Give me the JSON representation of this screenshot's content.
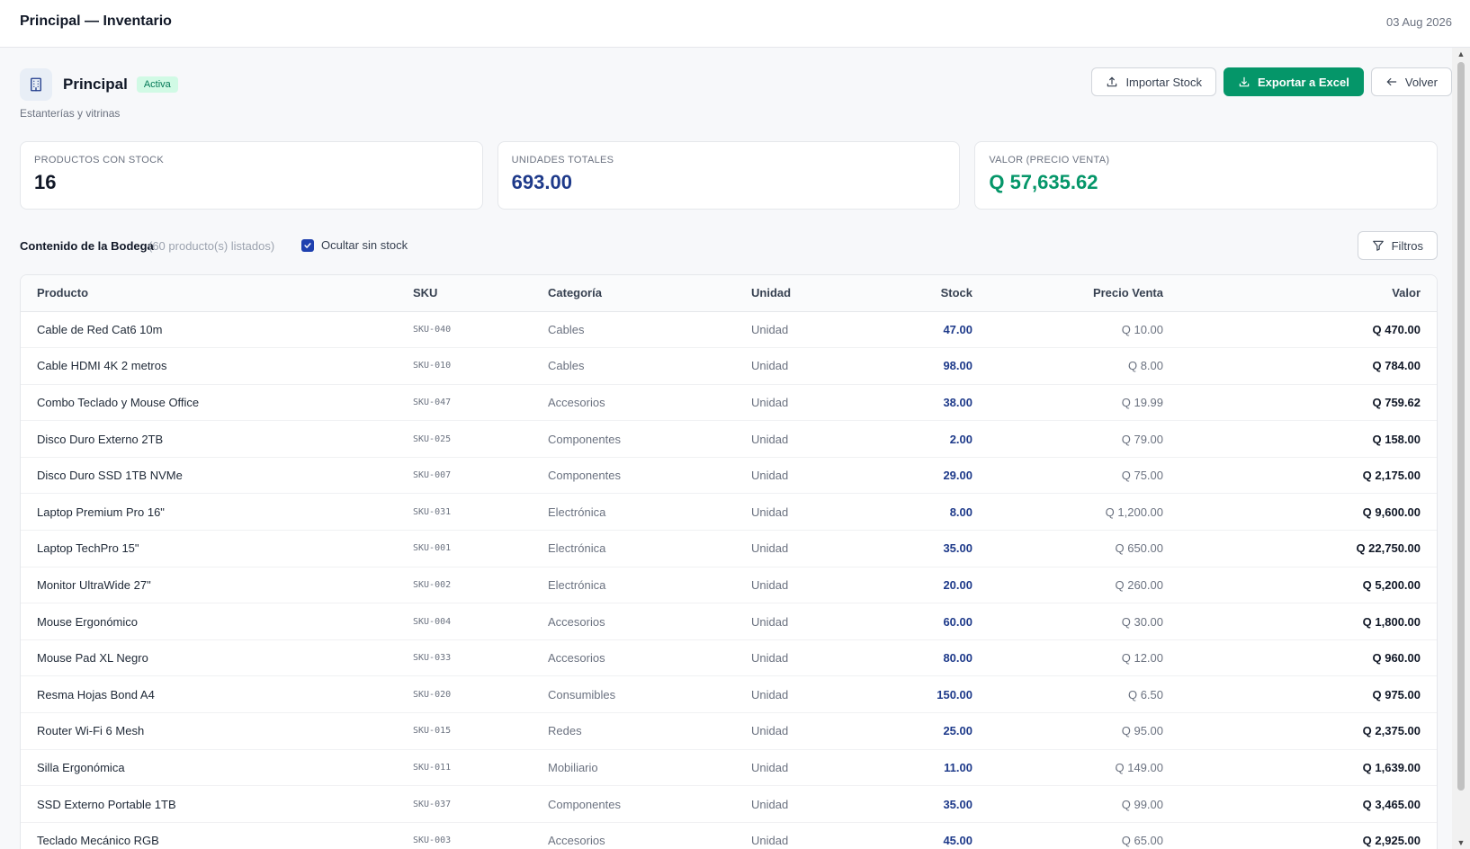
{
  "header": {
    "title": "Principal — Inventario",
    "date": "03 Aug 2026"
  },
  "warehouse": {
    "name": "Principal",
    "status": "Activa",
    "description": "Estanterías y vitrinas",
    "icon": "building-icon"
  },
  "actions": {
    "import_label": "Importar Stock",
    "export_label": "Exportar a Excel",
    "back_label": "Volver"
  },
  "stats": [
    {
      "label": "PRODUCTOS CON STOCK",
      "value": "16",
      "color": "#111827"
    },
    {
      "label": "UNIDADES TOTALES",
      "value": "693.00",
      "color": "#1e3a8a"
    },
    {
      "label": "VALOR (PRECIO VENTA)",
      "value": "Q 57,635.62",
      "color": "#059669"
    }
  ],
  "toolbar": {
    "heading": "Contenido de la Bodega",
    "count": "(60 producto(s) listados)",
    "hide_no_stock_label": "Ocultar sin stock",
    "hide_no_stock_checked": true,
    "filters_label": "Filtros"
  },
  "table": {
    "columns": [
      "Producto",
      "SKU",
      "Categoría",
      "Unidad",
      "Stock",
      "Precio Venta",
      "Valor"
    ],
    "rows": [
      {
        "product": "Cable de Red Cat6 10m",
        "sku": "SKU-040",
        "category": "Cables",
        "unit": "Unidad",
        "stock": "47.00",
        "price": "Q 10.00",
        "value": "Q 470.00"
      },
      {
        "product": "Cable HDMI 4K 2 metros",
        "sku": "SKU-010",
        "category": "Cables",
        "unit": "Unidad",
        "stock": "98.00",
        "price": "Q 8.00",
        "value": "Q 784.00"
      },
      {
        "product": "Combo Teclado y Mouse Office",
        "sku": "SKU-047",
        "category": "Accesorios",
        "unit": "Unidad",
        "stock": "38.00",
        "price": "Q 19.99",
        "value": "Q 759.62"
      },
      {
        "product": "Disco Duro Externo 2TB",
        "sku": "SKU-025",
        "category": "Componentes",
        "unit": "Unidad",
        "stock": "2.00",
        "price": "Q 79.00",
        "value": "Q 158.00"
      },
      {
        "product": "Disco Duro SSD 1TB NVMe",
        "sku": "SKU-007",
        "category": "Componentes",
        "unit": "Unidad",
        "stock": "29.00",
        "price": "Q 75.00",
        "value": "Q 2,175.00"
      },
      {
        "product": "Laptop Premium Pro 16\"",
        "sku": "SKU-031",
        "category": "Electrónica",
        "unit": "Unidad",
        "stock": "8.00",
        "price": "Q 1,200.00",
        "value": "Q 9,600.00"
      },
      {
        "product": "Laptop TechPro 15\"",
        "sku": "SKU-001",
        "category": "Electrónica",
        "unit": "Unidad",
        "stock": "35.00",
        "price": "Q 650.00",
        "value": "Q 22,750.00"
      },
      {
        "product": "Monitor UltraWide 27\"",
        "sku": "SKU-002",
        "category": "Electrónica",
        "unit": "Unidad",
        "stock": "20.00",
        "price": "Q 260.00",
        "value": "Q 5,200.00"
      },
      {
        "product": "Mouse Ergonómico",
        "sku": "SKU-004",
        "category": "Accesorios",
        "unit": "Unidad",
        "stock": "60.00",
        "price": "Q 30.00",
        "value": "Q 1,800.00"
      },
      {
        "product": "Mouse Pad XL Negro",
        "sku": "SKU-033",
        "category": "Accesorios",
        "unit": "Unidad",
        "stock": "80.00",
        "price": "Q 12.00",
        "value": "Q 960.00"
      },
      {
        "product": "Resma Hojas Bond A4",
        "sku": "SKU-020",
        "category": "Consumibles",
        "unit": "Unidad",
        "stock": "150.00",
        "price": "Q 6.50",
        "value": "Q 975.00"
      },
      {
        "product": "Router Wi-Fi 6 Mesh",
        "sku": "SKU-015",
        "category": "Redes",
        "unit": "Unidad",
        "stock": "25.00",
        "price": "Q 95.00",
        "value": "Q 2,375.00"
      },
      {
        "product": "Silla Ergonómica",
        "sku": "SKU-011",
        "category": "Mobiliario",
        "unit": "Unidad",
        "stock": "11.00",
        "price": "Q 149.00",
        "value": "Q 1,639.00"
      },
      {
        "product": "SSD Externo Portable 1TB",
        "sku": "SKU-037",
        "category": "Componentes",
        "unit": "Unidad",
        "stock": "35.00",
        "price": "Q 99.00",
        "value": "Q 3,465.00"
      },
      {
        "product": "Teclado Mecánico RGB",
        "sku": "SKU-003",
        "category": "Accesorios",
        "unit": "Unidad",
        "stock": "45.00",
        "price": "Q 65.00",
        "value": "Q 2,925.00"
      }
    ]
  }
}
